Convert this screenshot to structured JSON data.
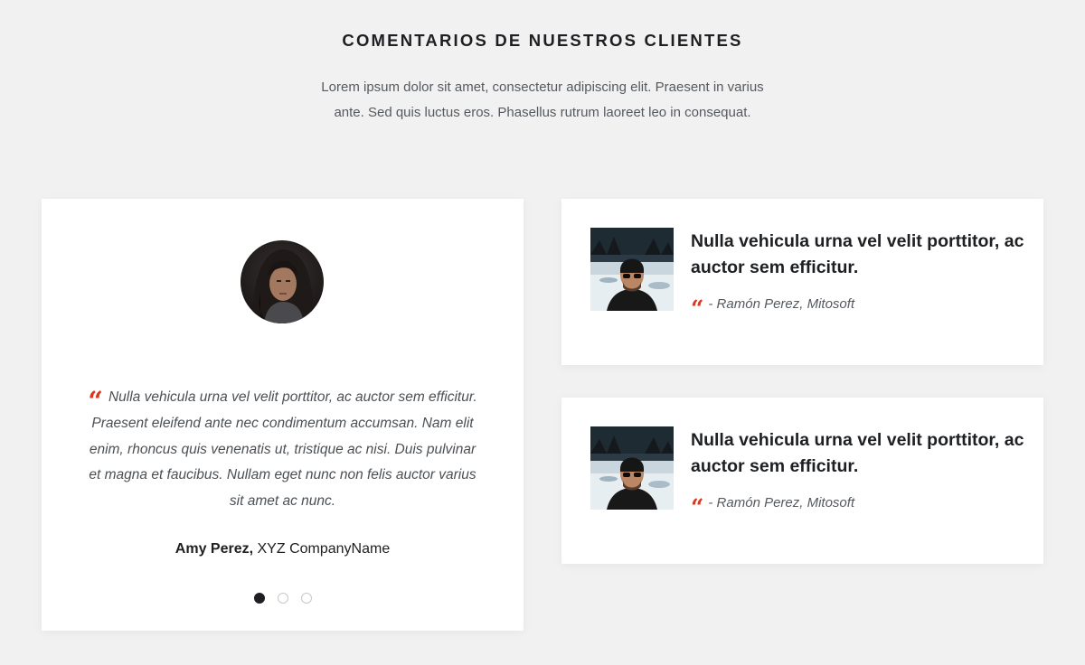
{
  "header": {
    "title": "COMENTARIOS DE NUESTROS CLIENTES",
    "description": "Lorem ipsum dolor sit amet, consectetur adipiscing elit. Praesent in varius ante. Sed quis luctus eros. Phasellus rutrum laoreet leo in consequat."
  },
  "featured": {
    "quote": "Nulla vehicula urna vel velit porttitor, ac auctor sem efficitur. Praesent eleifend ante nec condimentum accumsan. Nam elit enim, rhoncus quis venenatis ut, tristique ac nisi. Duis pulvinar et magna et faucibus. Nullam eget nunc non felis auctor varius sit amet ac nunc.",
    "quote_icon": "quote-mark-icon",
    "author_name": "Amy Perez,",
    "company": "XYZ CompanyName",
    "slides": 3,
    "active_slide": 1
  },
  "testimonials": [
    {
      "title": "Nulla vehicula urna vel velit porttitor, ac auctor sem efficitur.",
      "author": "- Ramón Perez, Mitosoft"
    },
    {
      "title": "Nulla vehicula urna vel velit porttitor, ac auctor sem efficitur.",
      "author": "- Ramón Perez, Mitosoft"
    }
  ],
  "colors": {
    "background": "#f1f1f1",
    "card": "#ffffff",
    "accent": "#d9381e",
    "heading": "#1d1f22",
    "body_text": "#555a60"
  }
}
